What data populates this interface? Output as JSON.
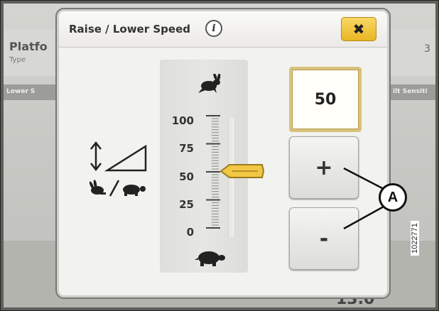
{
  "background": {
    "platform_label": "Platfo",
    "type_label": "Type",
    "lower_speed_label": "Lower S",
    "tilt_sensitivity_label": "ilt Sensiti",
    "right_value": "3",
    "bottom_value": "13.0"
  },
  "dialog": {
    "title": "Raise / Lower Speed",
    "info_icon": "i",
    "close_label": "✖"
  },
  "slider": {
    "scale_labels": [
      "100",
      "75",
      "50",
      "25",
      "0"
    ],
    "value": 50,
    "min": 0,
    "max": 100,
    "handle_color": "#f2c744"
  },
  "controls": {
    "current_value": "50",
    "plus_label": "+",
    "minus_label": "-"
  },
  "callout": {
    "label": "A"
  },
  "figure_number": "1022771"
}
